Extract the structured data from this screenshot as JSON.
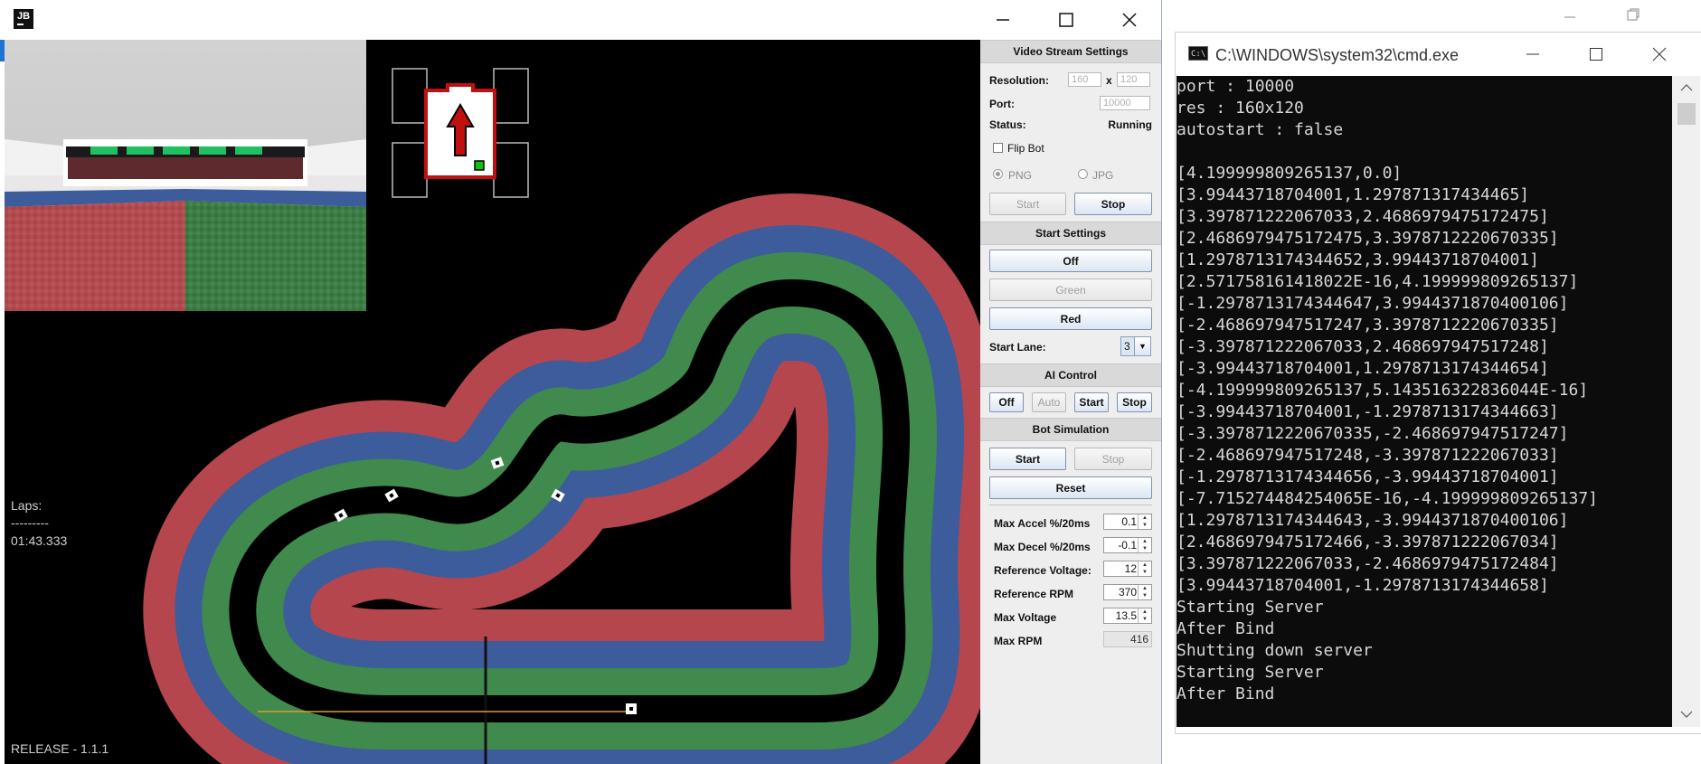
{
  "main_window": {
    "logo_text": "JB",
    "hud": {
      "laps_label": "Laps:",
      "separator": "---------",
      "lap_time": "01:43.333",
      "release": "RELEASE - 1.1.1"
    }
  },
  "panel": {
    "video": {
      "header": "Video Stream Settings",
      "resolution_label": "Resolution:",
      "res_w": "160",
      "res_x": "x",
      "res_h": "120",
      "port_label": "Port:",
      "port_value": "10000",
      "status_label": "Status:",
      "status_value": "Running",
      "flip_label": "Flip Bot",
      "png_label": "PNG",
      "jpg_label": "JPG",
      "start": "Start",
      "stop": "Stop"
    },
    "start_settings": {
      "header": "Start Settings",
      "off": "Off",
      "green": "Green",
      "red": "Red",
      "lane_label": "Start Lane:",
      "lane_value": "3"
    },
    "ai": {
      "header": "AI Control",
      "off": "Off",
      "auto": "Auto",
      "start": "Start",
      "stop": "Stop"
    },
    "sim": {
      "header": "Bot Simulation",
      "start": "Start",
      "stop": "Stop",
      "reset": "Reset"
    },
    "params": [
      {
        "label": "Max Accel %/20ms",
        "value": "0.1"
      },
      {
        "label": "Max Decel %/20ms",
        "value": "-0.1"
      },
      {
        "label": "Reference Voltage:",
        "value": "12"
      },
      {
        "label": "Reference RPM",
        "value": "370"
      },
      {
        "label": "Max Voltage",
        "value": "13.5"
      },
      {
        "label": "Max RPM",
        "value": "416"
      }
    ]
  },
  "console": {
    "title": "C:\\WINDOWS\\system32\\cmd.exe",
    "icon_text": "C:\\",
    "lines": [
      "port : 10000",
      "res : 160x120",
      "autostart : false",
      "",
      "[4.199999809265137,0.0]",
      "[3.99443718704001,1.297871317434465]",
      "[3.397871222067033,2.4686979475172475]",
      "[2.4686979475172475,3.3978712220670335]",
      "[1.2978713174344652,3.99443718704001]",
      "[2.571758161418022E-16,4.199999809265137]",
      "[-1.2978713174344647,3.9944371870400106]",
      "[-2.468697947517247,3.3978712220670335]",
      "[-3.397871222067033,2.468697947517248]",
      "[-3.99443718704001,1.2978713174344654]",
      "[-4.199999809265137,5.143516322836044E-16]",
      "[-3.99443718704001,-1.2978713174344663]",
      "[-3.3978712220670335,-2.468697947517247]",
      "[-2.468697947517248,-3.397871222067033]",
      "[-1.2978713174344656,-3.99443718704001]",
      "[-7.715274484254065E-16,-4.199999809265137]",
      "[1.2978713174344643,-3.9944371870400106]",
      "[2.4686979475172466,-3.397871222067034]",
      "[3.397871222067033,-2.4686979475172484]",
      "[3.99443718704001,-1.2978713174344658]",
      "Starting Server",
      "After Bind",
      "Shutting down server",
      "Starting Server",
      "After Bind"
    ]
  },
  "colors": {
    "lane_red": "#b5464e",
    "lane_blue": "#3d5c9c",
    "lane_green": "#3f8a4c",
    "accent_button": "#dbe6f3"
  }
}
